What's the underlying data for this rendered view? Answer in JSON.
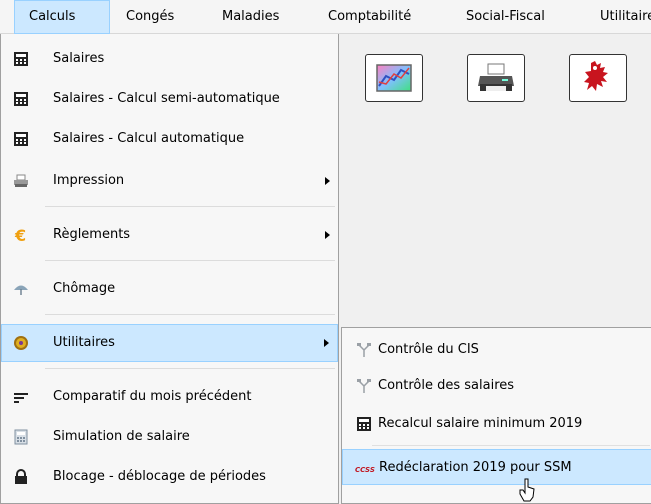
{
  "menubar": {
    "items": [
      "Calculs",
      "Congés",
      "Maladies",
      "Comptabilité",
      "Social-Fiscal",
      "Utilitaires"
    ]
  },
  "toolbar": {
    "buttons": [
      {
        "icon": "chart-image-icon"
      },
      {
        "icon": "printer-icon"
      },
      {
        "icon": "red-lion-emblem-icon"
      }
    ]
  },
  "calculs_menu": {
    "items": [
      {
        "label": "Salaires",
        "icon": "calculator-icon"
      },
      {
        "label": "Salaires - Calcul semi-automatique",
        "icon": "calculator-icon"
      },
      {
        "label": "Salaires - Calcul automatique",
        "icon": "calculator-icon"
      },
      {
        "label": "Impression",
        "icon": "printer-icon"
      },
      {
        "label": "Règlements",
        "icon": "euro-icon"
      },
      {
        "label": "Chômage",
        "icon": "umbrella-icon"
      },
      {
        "label": "Utilitaires",
        "icon": "gear-icon"
      },
      {
        "label": "Comparatif du mois précédent",
        "icon": "lines-icon"
      },
      {
        "label": "Simulation de salaire",
        "icon": "calculator-light-icon"
      },
      {
        "label": "Blocage - déblocage de périodes",
        "icon": "lock-icon"
      }
    ]
  },
  "utilitaires_submenu": {
    "items": [
      {
        "label": "Contrôle du CIS",
        "icon": "tools-icon"
      },
      {
        "label": "Contrôle des salaires",
        "icon": "tools-icon"
      },
      {
        "label": "Recalcul salaire minimum 2019",
        "icon": "calculator-icon"
      },
      {
        "label": "Redéclaration 2019 pour SSM",
        "icon": "ccss-logo-icon",
        "logo_text": "CCSS"
      }
    ]
  },
  "colors": {
    "highlight_bg": "#cce8ff",
    "highlight_border": "#99d1ff"
  }
}
